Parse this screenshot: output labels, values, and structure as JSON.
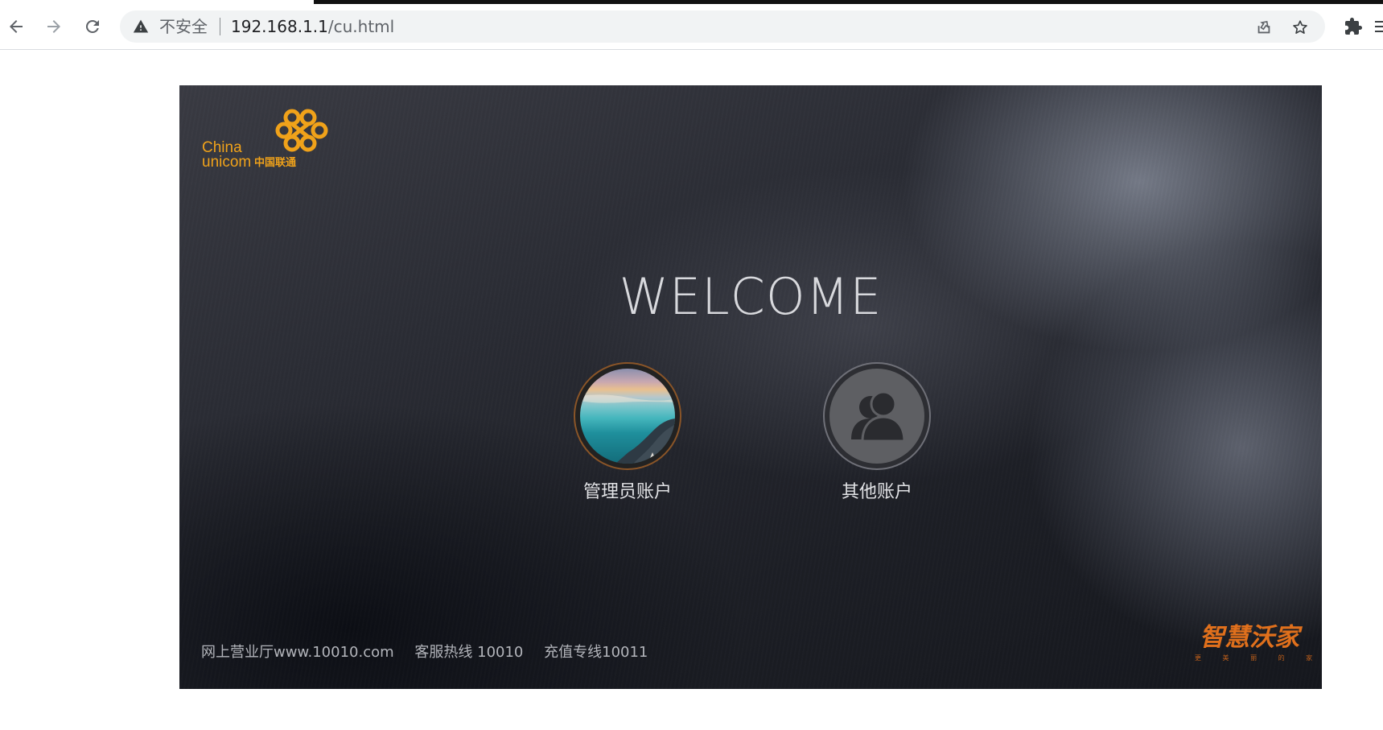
{
  "browser": {
    "security_label": "不安全",
    "url_host": "192.168.1.1",
    "url_path": "/cu.html"
  },
  "icons": {
    "back": "arrow-left-icon",
    "forward": "arrow-right-icon",
    "reload": "reload-icon",
    "warning": "warning-triangle-icon",
    "share": "share-icon",
    "bookmark": "star-icon",
    "extensions": "puzzle-icon",
    "menu": "more-vert-icon",
    "user": "users-icon"
  },
  "colors": {
    "brand_orange": "#f0a21a",
    "brand_alt": "#e0701c"
  },
  "login": {
    "logo": {
      "line1": "China",
      "line2": "unicom",
      "cn": "中国联通"
    },
    "welcome": "WELCOME",
    "accounts": [
      {
        "label": "管理员账户"
      },
      {
        "label": "其他账户"
      }
    ],
    "footer": {
      "hall": "网上营业厅www.10010.com",
      "hotline": "客服热线 10010",
      "recharge": "充值专线10011"
    },
    "brand": {
      "name": "智慧沃家",
      "sub": "更 美 丽 的 家"
    }
  }
}
